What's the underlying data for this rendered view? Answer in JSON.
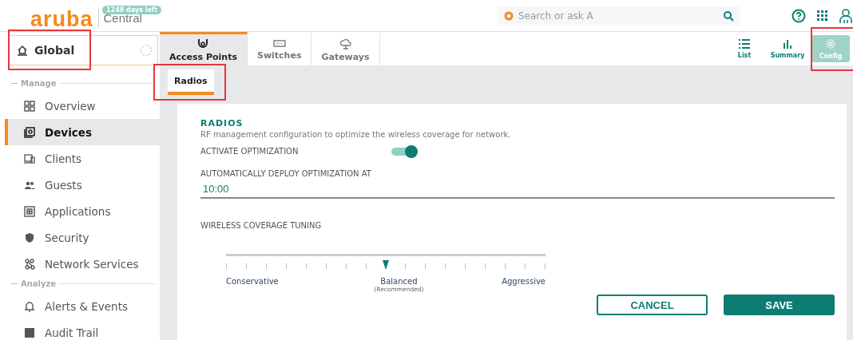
{
  "header": {
    "logo": "aruba",
    "product": "Central",
    "license_badge": "1248 days left",
    "search": {
      "placeholder": "Search or ask A"
    }
  },
  "scope": {
    "label": "Global"
  },
  "device_tabs": [
    {
      "label": "Access Points",
      "kind": "ap",
      "selected": true
    },
    {
      "label": "Switches",
      "kind": "switch",
      "selected": false
    },
    {
      "label": "Gateways",
      "kind": "gateway",
      "selected": false
    }
  ],
  "view_tabs": [
    {
      "label": "List",
      "kind": "list",
      "selected": false
    },
    {
      "label": "Summary",
      "kind": "summary",
      "selected": false
    },
    {
      "label": "Config",
      "kind": "config",
      "selected": true
    }
  ],
  "sub_tabs": [
    {
      "label": "Radios",
      "selected": true
    }
  ],
  "sidebar": {
    "sections": [
      {
        "title": "Manage",
        "items": [
          {
            "label": "Overview",
            "kind": "overview",
            "selected": false
          },
          {
            "label": "Devices",
            "kind": "devices",
            "selected": true
          },
          {
            "label": "Clients",
            "kind": "clients",
            "selected": false
          },
          {
            "label": "Guests",
            "kind": "guests",
            "selected": false
          },
          {
            "label": "Applications",
            "kind": "applications",
            "selected": false
          },
          {
            "label": "Security",
            "kind": "security",
            "selected": false
          },
          {
            "label": "Network Services",
            "kind": "network",
            "selected": false
          }
        ]
      },
      {
        "title": "Analyze",
        "items": [
          {
            "label": "Alerts & Events",
            "kind": "alerts",
            "selected": false
          },
          {
            "label": "Audit Trail",
            "kind": "audit",
            "selected": false
          }
        ]
      }
    ]
  },
  "radios": {
    "title": "RADIOS",
    "description": "RF management configuration to optimize the wireless coverage for network.",
    "activate_optimization": {
      "label": "ACTIVATE OPTIMIZATION",
      "on": true
    },
    "deploy_time": {
      "label": "AUTOMATICALLY DEPLOY OPTIMIZATION AT",
      "value": "10:00"
    },
    "coverage_tuning": {
      "label": "WIRELESS COVERAGE TUNING",
      "level": 0.5,
      "left_label": "Conservative",
      "center_label": "Balanced",
      "center_note": "(Recommended)",
      "right_label": "Aggressive"
    },
    "buttons": [
      {
        "label": "CANCEL",
        "kind": "secondary"
      },
      {
        "label": "SAVE",
        "kind": "primary"
      }
    ]
  }
}
